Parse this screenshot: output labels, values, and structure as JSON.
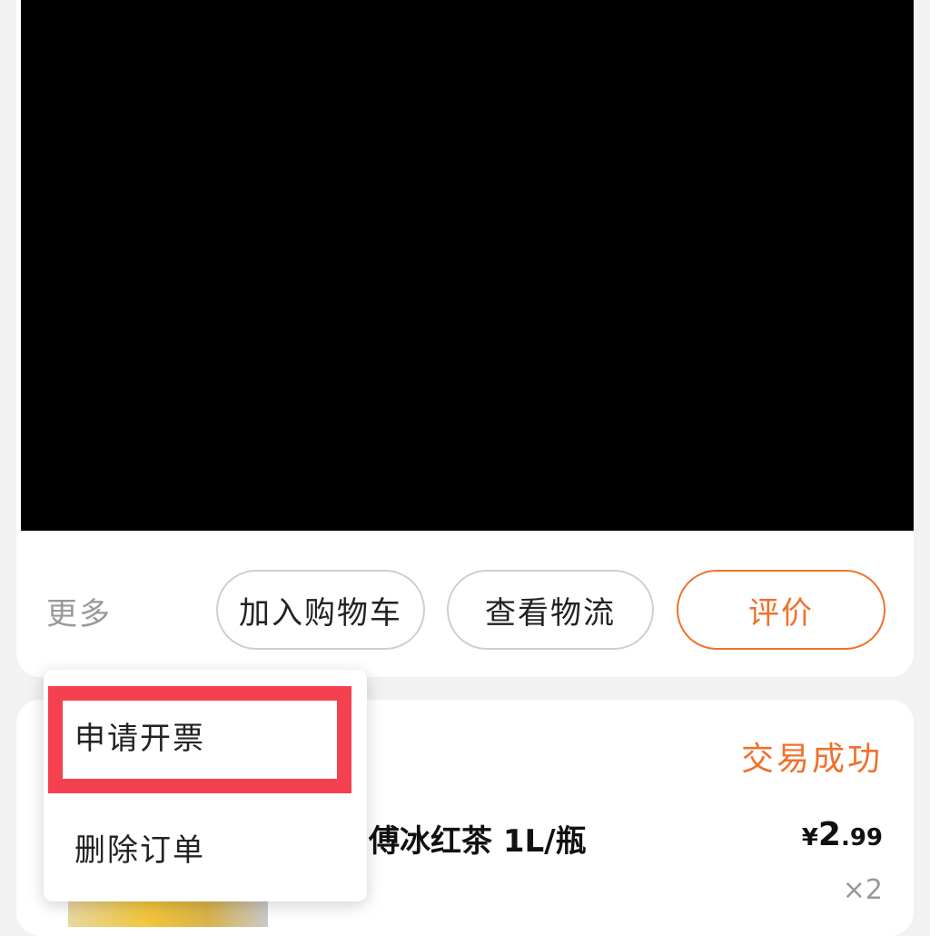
{
  "actions": {
    "more_label": "更多",
    "add_to_cart": "加入购物车",
    "view_logistics": "查看物流",
    "review": "评价"
  },
  "more_menu": {
    "items": [
      "申请开票",
      "删除订单"
    ]
  },
  "order": {
    "status": "交易成功",
    "product_name": "傅冰红茶 1L/瓶",
    "price_currency": "¥",
    "price_integer": "2",
    "price_decimal": ".99",
    "quantity": "×2"
  },
  "colors": {
    "accent": "#f0702c",
    "highlight": "#f5404f"
  }
}
